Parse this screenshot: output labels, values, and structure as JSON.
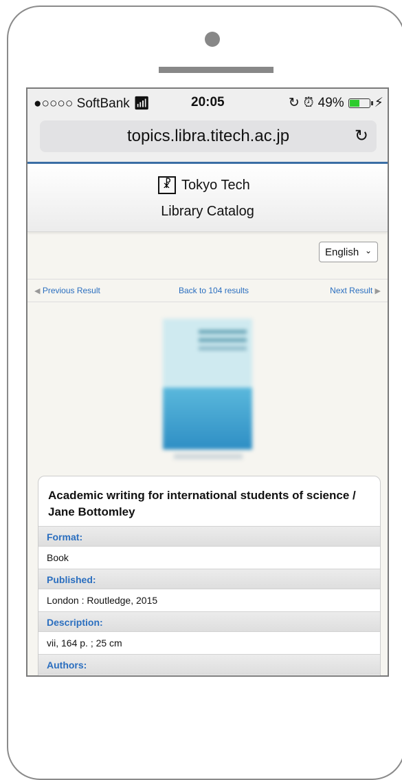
{
  "status_bar": {
    "carrier": "●○○○○ SoftBank",
    "time": "20:05",
    "battery": "49%"
  },
  "browser": {
    "url": "topics.libra.titech.ac.jp",
    "reload_icon": "reload-icon"
  },
  "header": {
    "logo_text": "Tokyo Tech",
    "subtitle": "Library Catalog"
  },
  "language": {
    "selected": "English"
  },
  "navigation": {
    "previous": "Previous Result",
    "back": "Back to 104 results",
    "next": "Next Result"
  },
  "record": {
    "title": "Academic writing for international students of science / Jane Bottomley",
    "fields": [
      {
        "label": "Format:",
        "value": "Book"
      },
      {
        "label": "Published:",
        "value": "London : Routledge, 2015"
      },
      {
        "label": "Description:",
        "value": "vii, 164 p. ; 25 cm"
      },
      {
        "label": "Authors:",
        "value": ""
      }
    ]
  },
  "colors": {
    "accent": "#2a6ebf",
    "url_underline": "#3a6ea5",
    "battery_fill": "#2ecc2e"
  }
}
